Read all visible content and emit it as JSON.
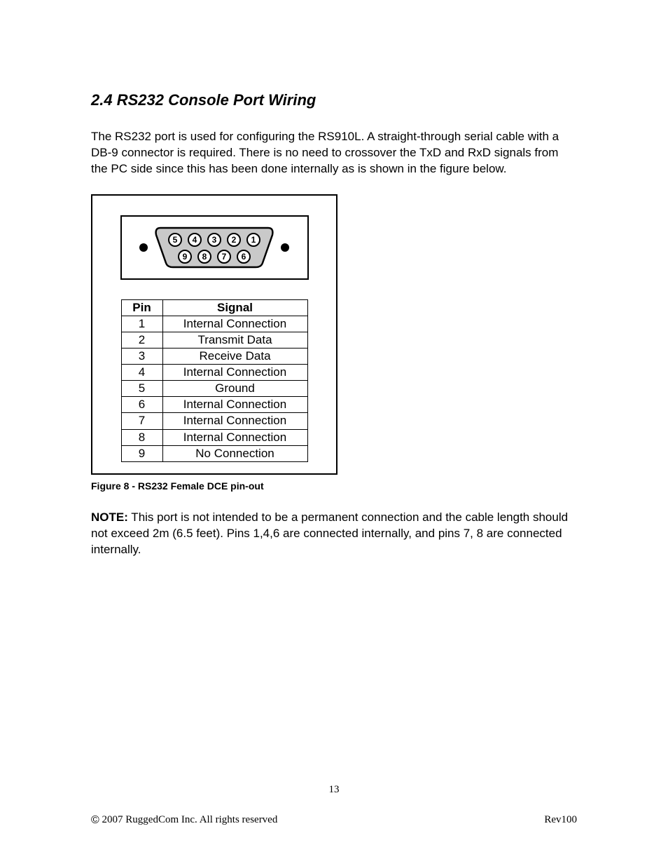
{
  "heading": "2.4  RS232 Console Port Wiring",
  "intro": "The RS232 port is used for configuring the RS910L. A straight-through serial cable with a DB-9 connector is required. There is no need to crossover the TxD and RxD signals from the PC side since this has been done internally as is shown in the figure below.",
  "connector": {
    "top_row": [
      "5",
      "4",
      "3",
      "2",
      "1"
    ],
    "bottom_row": [
      "9",
      "8",
      "7",
      "6"
    ]
  },
  "table": {
    "headers": {
      "pin": "Pin",
      "signal": "Signal"
    },
    "rows": [
      {
        "pin": "1",
        "signal": "Internal Connection"
      },
      {
        "pin": "2",
        "signal": "Transmit Data"
      },
      {
        "pin": "3",
        "signal": "Receive Data"
      },
      {
        "pin": "4",
        "signal": "Internal Connection"
      },
      {
        "pin": "5",
        "signal": "Ground"
      },
      {
        "pin": "6",
        "signal": "Internal Connection"
      },
      {
        "pin": "7",
        "signal": "Internal Connection"
      },
      {
        "pin": "8",
        "signal": "Internal Connection"
      },
      {
        "pin": "9",
        "signal": "No Connection"
      }
    ]
  },
  "figure_caption": "Figure 8 - RS232 Female DCE pin-out",
  "note_label": "NOTE:",
  "note_text": " This port is not intended to be a permanent connection and the cable length should not exceed 2m (6.5 feet). Pins 1,4,6 are connected internally, and pins 7, 8 are connected internally.",
  "footer": {
    "page_number": "13",
    "copyright_symbol": "©",
    "copyright_text": " 2007 RuggedCom Inc. All rights reserved",
    "revision": "Rev100"
  }
}
